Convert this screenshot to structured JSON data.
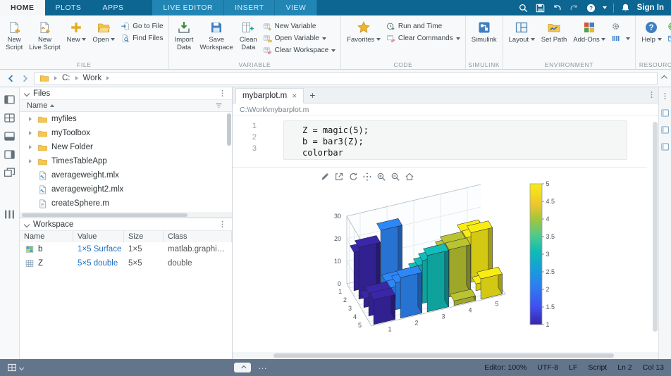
{
  "colors": {
    "ribbon_blue": "#0d6591",
    "ribbon_context_blue": "#2286b5",
    "toolstrip_bg": "#f7f9fa",
    "statusbar_bg": "#62758a",
    "accent_gold": "#e3a41f"
  },
  "glyphs": {
    "close": "×",
    "new_tab": "+",
    "more": "…"
  },
  "ribbon": {
    "tabs": [
      "HOME",
      "PLOTS",
      "APPS"
    ],
    "active_tab": "HOME",
    "context_tabs": [
      "LIVE EDITOR",
      "INSERT",
      "VIEW"
    ],
    "right_icons": [
      "search",
      "save",
      "undo",
      "redo",
      "help-circle"
    ],
    "bell_icon": "bell",
    "sign_in_label": "Sign In"
  },
  "toolstrip": {
    "sections": [
      {
        "label": "FILE",
        "items": [
          {
            "type": "large",
            "lines": [
              "New",
              "Script"
            ],
            "icon": "new-script",
            "name": "new-script"
          },
          {
            "type": "large",
            "lines": [
              "New",
              "Live Script"
            ],
            "icon": "new-live-script",
            "name": "new-live-script"
          },
          {
            "type": "large",
            "lines": [
              "New"
            ],
            "icon": "new",
            "arrow": true,
            "name": "new"
          },
          {
            "type": "large",
            "lines": [
              "Open"
            ],
            "icon": "open",
            "arrow": true,
            "name": "open"
          },
          {
            "type": "stack",
            "items": [
              {
                "label": "Go to File",
                "icon": "go-to-file",
                "name": "go-to-file"
              },
              {
                "label": "Find Files",
                "icon": "find-files",
                "name": "find-files"
              }
            ]
          }
        ]
      },
      {
        "label": "VARIABLE",
        "items": [
          {
            "type": "large",
            "lines": [
              "Import",
              "Data"
            ],
            "icon": "import-data",
            "name": "import-data"
          },
          {
            "type": "large",
            "lines": [
              "Save",
              "Workspace"
            ],
            "icon": "save-workspace",
            "name": "save-workspace"
          },
          {
            "type": "large",
            "lines": [
              "Clean",
              "Data"
            ],
            "icon": "clean-data",
            "name": "clean-data"
          },
          {
            "type": "stack",
            "items": [
              {
                "label": "New Variable",
                "icon": "new-variable",
                "name": "new-variable"
              },
              {
                "label": "Open Variable",
                "icon": "open-variable",
                "arrow": true,
                "name": "open-variable"
              },
              {
                "label": "Clear Workspace",
                "icon": "clear-workspace",
                "arrow": true,
                "name": "clear-workspace"
              }
            ]
          }
        ]
      },
      {
        "label": "CODE",
        "items": [
          {
            "type": "large",
            "lines": [
              "Favorites"
            ],
            "icon": "favorites",
            "arrow": true,
            "name": "favorites"
          },
          {
            "type": "stack",
            "items": [
              {
                "label": "Run and Time",
                "icon": "run-and-time",
                "name": "run-and-time"
              },
              {
                "label": "Clear Commands",
                "icon": "clear-commands",
                "arrow": true,
                "name": "clear-commands"
              }
            ]
          }
        ]
      },
      {
        "label": "SIMULINK",
        "items": [
          {
            "type": "large",
            "lines": [
              "Simulink"
            ],
            "icon": "simulink",
            "name": "simulink"
          }
        ]
      },
      {
        "label": "ENVIRONMENT",
        "items": [
          {
            "type": "large",
            "lines": [
              "Layout"
            ],
            "icon": "layout",
            "arrow": true,
            "name": "layout"
          },
          {
            "type": "large",
            "lines": [
              "Set Path"
            ],
            "icon": "set-path",
            "name": "set-path"
          },
          {
            "type": "large",
            "lines": [
              "Add-Ons"
            ],
            "icon": "add-ons",
            "arrow": true,
            "name": "add-ons"
          },
          {
            "type": "stack",
            "items": [
              {
                "label": "",
                "icon": "gear",
                "name": "preferences"
              },
              {
                "label": "",
                "icon": "parallel",
                "arrow": true,
                "name": "parallel"
              }
            ]
          }
        ]
      },
      {
        "label": "RESOURCES",
        "items": [
          {
            "type": "large",
            "lines": [
              "Help"
            ],
            "icon": "help-blue",
            "arrow": true,
            "name": "help"
          },
          {
            "type": "stack",
            "items": [
              {
                "label": "",
                "icon": "community",
                "name": "community"
              },
              {
                "label": "",
                "icon": "request-support",
                "name": "request-support"
              }
            ]
          }
        ]
      }
    ]
  },
  "address_bar": {
    "breadcrumb": [
      "C:",
      "Work"
    ]
  },
  "left_rail_icons": [
    "window-left-panel",
    "window-grid",
    "window-bottom-panel",
    "window-right-panel",
    "window-float",
    "window-columns"
  ],
  "files_panel": {
    "title": "Files",
    "name_column": "Name",
    "items": [
      {
        "name": "myfiles",
        "type": "folder"
      },
      {
        "name": "myToolbox",
        "type": "folder"
      },
      {
        "name": "New Folder",
        "type": "folder"
      },
      {
        "name": "TimesTableApp",
        "type": "folder"
      },
      {
        "name": "averageweight.mlx",
        "type": "mlx"
      },
      {
        "name": "averageweight2.mlx",
        "type": "mlx"
      },
      {
        "name": "createSphere.m",
        "type": "m"
      }
    ]
  },
  "workspace_panel": {
    "title": "Workspace",
    "columns": [
      "Name",
      "Value",
      "Size",
      "Class"
    ],
    "rows": [
      {
        "name": "b",
        "icon": "surface-var",
        "value": "1×5 Surface",
        "size": "1×5",
        "class": "matlab.graphi…"
      },
      {
        "name": "Z",
        "icon": "matrix-var",
        "value": "5×5 double",
        "size": "5×5",
        "class": "double"
      }
    ]
  },
  "editor": {
    "tab_label": "mybarplot.m",
    "path": "C:\\Work\\mybarplot.m",
    "lines": [
      {
        "no": "1",
        "code": "Z = magic(5);"
      },
      {
        "no": "2",
        "code": "b = bar3(Z);"
      },
      {
        "no": "3",
        "code": "colorbar"
      }
    ]
  },
  "chart_data": {
    "type": "bar",
    "subtype": "bar3",
    "source_expression": "bar3(magic(5))",
    "rows": [
      [
        17,
        24,
        1,
        8,
        15
      ],
      [
        23,
        5,
        7,
        14,
        16
      ],
      [
        4,
        6,
        13,
        20,
        22
      ],
      [
        10,
        12,
        19,
        21,
        3
      ],
      [
        11,
        18,
        25,
        2,
        9
      ]
    ],
    "x_ticks": [
      1,
      2,
      3,
      4,
      5
    ],
    "y_ticks": [
      1,
      2,
      3,
      4,
      5
    ],
    "z_ticks": [
      0,
      10,
      20,
      30
    ],
    "zlim": [
      0,
      30
    ],
    "grid": true,
    "series_colors": [
      "#3a26a8",
      "#2e87f7",
      "#12beb9",
      "#b9c430",
      "#f9ec15"
    ],
    "colorbar": {
      "min": 1,
      "max": 5,
      "ticks": [
        1,
        1.5,
        2,
        2.5,
        3,
        3.5,
        4,
        4.5,
        5
      ],
      "gradient": [
        {
          "offset": 0.0,
          "color": "#3a26a8"
        },
        {
          "offset": 0.13,
          "color": "#4150f2"
        },
        {
          "offset": 0.27,
          "color": "#2e7df0"
        },
        {
          "offset": 0.4,
          "color": "#15a0d8"
        },
        {
          "offset": 0.52,
          "color": "#0fbcb4"
        },
        {
          "offset": 0.63,
          "color": "#4ccb8c"
        },
        {
          "offset": 0.75,
          "color": "#a2c63a"
        },
        {
          "offset": 0.85,
          "color": "#edc52e"
        },
        {
          "offset": 1.0,
          "color": "#f9ec15"
        }
      ]
    },
    "toolbar_icons": [
      "brush",
      "export",
      "rotate",
      "pan",
      "zoom-in",
      "zoom-out",
      "home"
    ]
  },
  "status_bar": {
    "items": [
      "Editor: 100%",
      "UTF-8",
      "LF",
      "Script",
      "Ln 2",
      "Col 13"
    ]
  }
}
